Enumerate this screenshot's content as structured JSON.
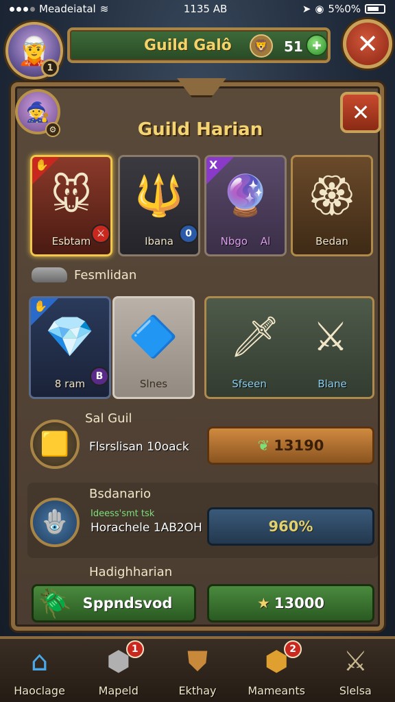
{
  "status_bar": {
    "carrier": "Meadeiatal",
    "time": "1135 AB",
    "battery": "5%0%"
  },
  "header": {
    "title": "Guild Galô",
    "count": "51",
    "avatar_level": "1"
  },
  "panel": {
    "title": "Guild Harian",
    "items_row1": [
      {
        "label": "Esbtam",
        "icon": "rat-knight-icon",
        "tag_icon": "hand-icon",
        "corner": "red"
      },
      {
        "label": "Ibana",
        "icon": "staff-icon",
        "badge": "0"
      },
      {
        "label": "Nbgo",
        "icon": "orb-icon",
        "tag": "X",
        "badge": "Al"
      },
      {
        "label": "Bedan",
        "icon": "amulet-icon"
      }
    ],
    "section_label": "Fesmlidan",
    "items_row2": [
      {
        "label": "8 ram",
        "icon": "crystal-staff-icon",
        "badge": "B"
      },
      {
        "label": "Slnes",
        "icon": "crystal-icon"
      },
      {
        "label_left": "Sfseen",
        "label_right": "Blane",
        "icon_left": "spear-icon",
        "icon_right": "sword-icon"
      }
    ],
    "rows": [
      {
        "title": "Sal Guil",
        "desc": "Flsrslisan 10oack",
        "button": "13190",
        "icon": "gold-cube-icon"
      },
      {
        "title": "Bsdanario",
        "sub": "Ideess'smt tsk",
        "desc": "Horachele 1AB2OH",
        "button": "960%",
        "icon": "magic-amulet-icon"
      },
      {
        "title": "Hadighharian",
        "button_left": "Sppndsvod",
        "button": "13000",
        "icon": "scarab-icon"
      }
    ]
  },
  "bottom_nav": [
    {
      "label": "Haoclage",
      "icon": "home-icon",
      "badge": ""
    },
    {
      "label": "Mapeld",
      "icon": "cube-icon",
      "badge": "1"
    },
    {
      "label": "Ekthay",
      "icon": "shield-icon",
      "badge": ""
    },
    {
      "label": "Mameants",
      "icon": "chest-icon",
      "badge": "2"
    },
    {
      "label": "Slelsa",
      "icon": "swords-icon",
      "badge": ""
    }
  ]
}
